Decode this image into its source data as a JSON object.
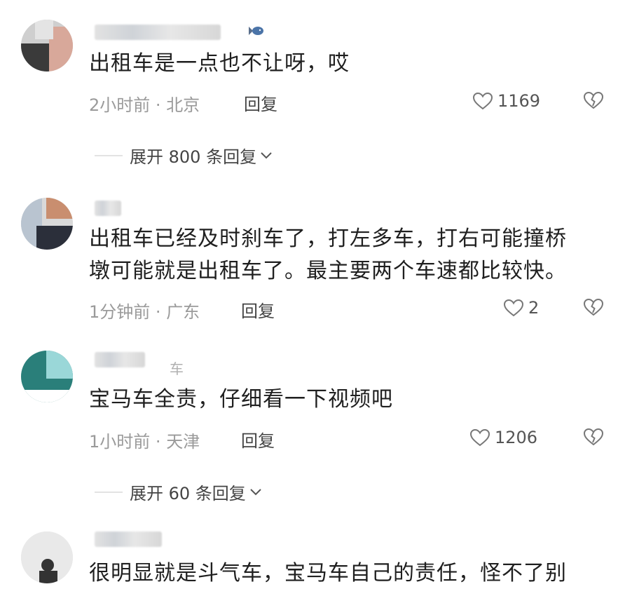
{
  "comments": [
    {
      "text": "出租车是一点也不让呀，哎",
      "time": "2小时前",
      "location": "北京",
      "reply_label": "回复",
      "likes": "1169",
      "expand": "展开 800 条回复"
    },
    {
      "text_lines": [
        "出租车已经及时刹车了，打左多车，打右可能撞桥",
        "墩可能就是出租车了。最主要两个车速都比较快。"
      ],
      "time": "1分钟前",
      "location": "广东",
      "reply_label": "回复",
      "likes": "2"
    },
    {
      "name_suffix": "车",
      "text": "宝马车全责，仔细看一下视频吧",
      "time": "1小时前",
      "location": "天津",
      "reply_label": "回复",
      "likes": "1206",
      "expand": "展开 60 条回复"
    },
    {
      "text": "很明显就是斗气车，宝马车自己的责任，怪不了别"
    }
  ],
  "icons": {
    "like": "heart-outline-icon",
    "dislike": "broken-heart-icon",
    "expand": "chevron-down-icon",
    "badge": "fish-badge-icon"
  },
  "colors": {
    "meta": "#9a9a9a",
    "text": "#1f1f1f",
    "icon": "#777777"
  }
}
